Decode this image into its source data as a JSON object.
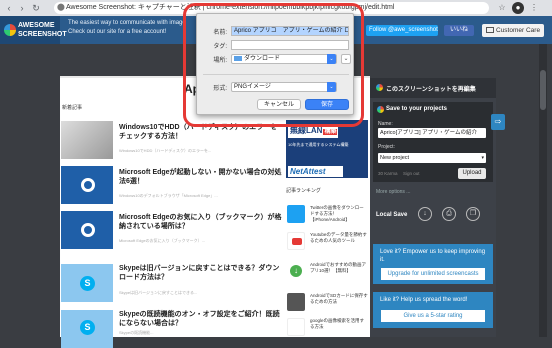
{
  "browser": {
    "tab_title": "Awesome Screenshot: キャプチャーと注釈",
    "url_rest": "chrome-extension://nlipoenfbbikpbjkfpfillcgkoblgpmj/edit.html",
    "url_full": "Awesome Screenshot: キャプチャーと注釈 | chrome-extension://nlipoenfbbikpbjkfpfillcgkoblgpmj/edit.html"
  },
  "banner": {
    "logo_line1": "AWESOME",
    "logo_line2": "SCREENSHOT",
    "tagline": "The easiest way to communicate with image",
    "subline": "Check out our site for a free account!",
    "follow": "Follow @awe_screenshot",
    "like": "いいね",
    "customer_care": "Customer Care"
  },
  "dialog": {
    "name_label": "名前:",
    "name_value": "Aprico アプリコ　アプリ・ゲームの紹介",
    "name_suffix": "ログ",
    "tag_label": "タグ:",
    "location_label": "場所:",
    "location_value": "ダウンロード",
    "format_label": "形式:",
    "format_value": "PNGイメージ",
    "cancel": "キャンセル",
    "save": "保存"
  },
  "webpage": {
    "header_partial": "Ap",
    "section_label": "新着記事",
    "articles": [
      {
        "title": "Windows10でHDD（ハードディスク）のエラーをチェックする方法！",
        "meta": "Windows10でHDD（ハードディスク）のエラーを..."
      },
      {
        "title": "Microsoft Edgeが起動しない・開かない場合の対処法6選！",
        "meta": "Windows10のデフォルトブラウザ「Microsoft Edge」..."
      },
      {
        "title": "Microsoft Edgeのお気に入り（ブックマーク）が格納されている場所は？",
        "meta": "Microsoft Edgeのお気に入り（ブックマーク）..."
      },
      {
        "title": "Skypeは旧バージョンに戻すことはできる？ダウンロード方法は？",
        "meta": "Skypeは旧バージョンに戻すことはできる..."
      },
      {
        "title": "Skypeの既読機能のオン・オフ設定をご紹介！既読にならない場合は？",
        "meta": "Skypeの既読機能..."
      }
    ],
    "ad": {
      "title": "無線LAN",
      "badge": "構築",
      "sub": "10年先まで通用するシステム構築",
      "brand": "NetAttest"
    },
    "ranking_label": "記事ランキング",
    "ranking": [
      "Twitterの画像をダウンロードする方法！【iPhone/Android】",
      "Youtubeのデータ量を節約するための人気のツール",
      "Androidでおすすめの動画アプリ10選！【無料】",
      "AndroidでSDカードに保存するための方法",
      "googleの画像検索を活用する方法"
    ]
  },
  "panel": {
    "header": "このスクリーンショットを再編集",
    "card_title": "Save to your projects",
    "name_label": "Name:",
    "name_value": "Aprico[アプリコ] アプリ・ゲームの紹介",
    "project_label": "Project:",
    "project_value": "New project",
    "karma": "30 Karma",
    "sign_out": "Sign out",
    "upload": "Upload",
    "more_options": "More options ...",
    "local_save": "Local Save",
    "promo1_text": "Love it? Empower us to keep improving it.",
    "promo1_btn": "Upgrade for unlimited screencasts",
    "promo2_text": "Like it? Help us spread the word!",
    "promo2_btn": "Give us a 5-star rating"
  }
}
